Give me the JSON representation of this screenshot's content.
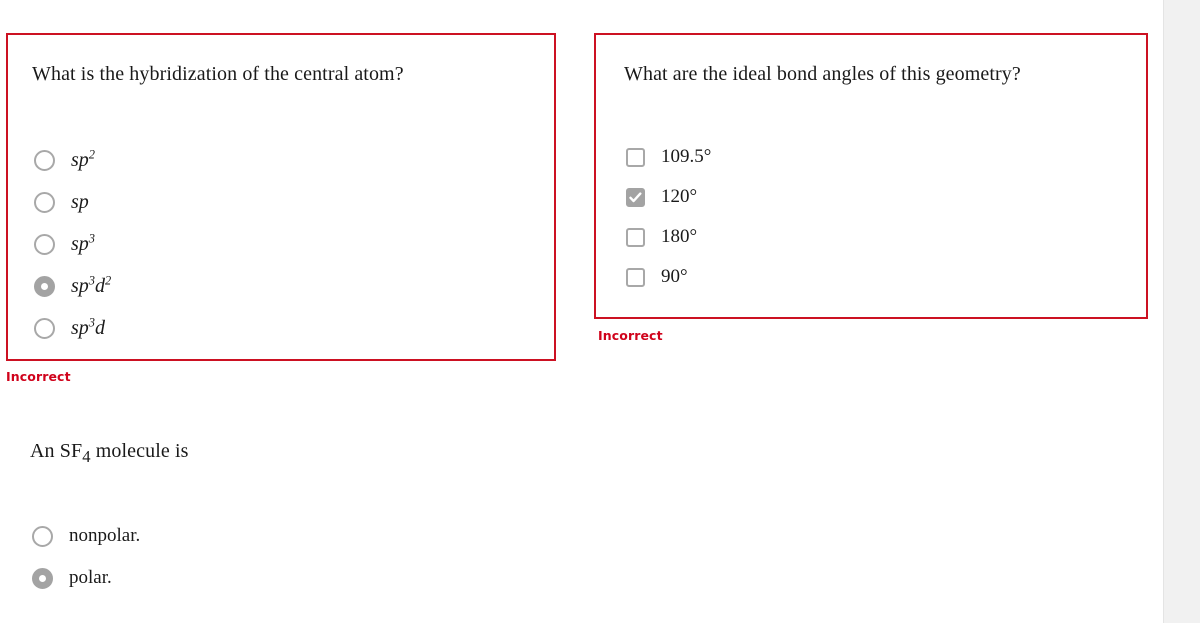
{
  "feedback_label": "Incorrect",
  "accent_colors": {
    "card_border_red": "#cc1122",
    "feedback_red": "#d0021b",
    "control_gray": "#a3a3a3",
    "control_border_gray": "#a8a8a8",
    "scrollbar_track": "#f1f1f1"
  },
  "questions": [
    {
      "id": "hybridization",
      "prompt": "What is the hybridization of the central atom?",
      "control_type": "radio",
      "bordered": true,
      "feedback": "Incorrect",
      "options": [
        {
          "label_html": "sp<sup>2</sup>",
          "plain": "sp2",
          "selected": false,
          "math": true
        },
        {
          "label_html": "sp",
          "plain": "sp",
          "selected": false,
          "math": true
        },
        {
          "label_html": "sp<sup>3</sup>",
          "plain": "sp3",
          "selected": false,
          "math": true
        },
        {
          "label_html": "sp<sup>3</sup>d<sup>2</sup>",
          "plain": "sp3d2",
          "selected": true,
          "math": true
        },
        {
          "label_html": "sp<sup>3</sup>d",
          "plain": "sp3d",
          "selected": false,
          "math": true
        }
      ]
    },
    {
      "id": "bond-angles",
      "prompt": "What are the ideal bond angles of this geometry?",
      "control_type": "checkbox",
      "bordered": true,
      "feedback": "Incorrect",
      "options": [
        {
          "label_html": "109.5°",
          "plain": "109.5°",
          "selected": false,
          "math": false
        },
        {
          "label_html": "120°",
          "plain": "120°",
          "selected": true,
          "math": false
        },
        {
          "label_html": "180°",
          "plain": "180°",
          "selected": false,
          "math": false
        },
        {
          "label_html": "90°",
          "plain": "90°",
          "selected": false,
          "math": false
        }
      ]
    },
    {
      "id": "sf4-polarity",
      "prompt_html": "An SF<sub>4</sub> molecule is",
      "prompt": "An SF4 molecule is",
      "control_type": "radio",
      "bordered": false,
      "feedback": null,
      "options": [
        {
          "label_html": "nonpolar.",
          "plain": "nonpolar.",
          "selected": false,
          "math": false
        },
        {
          "label_html": "polar.",
          "plain": "polar.",
          "selected": true,
          "math": false
        }
      ]
    }
  ]
}
